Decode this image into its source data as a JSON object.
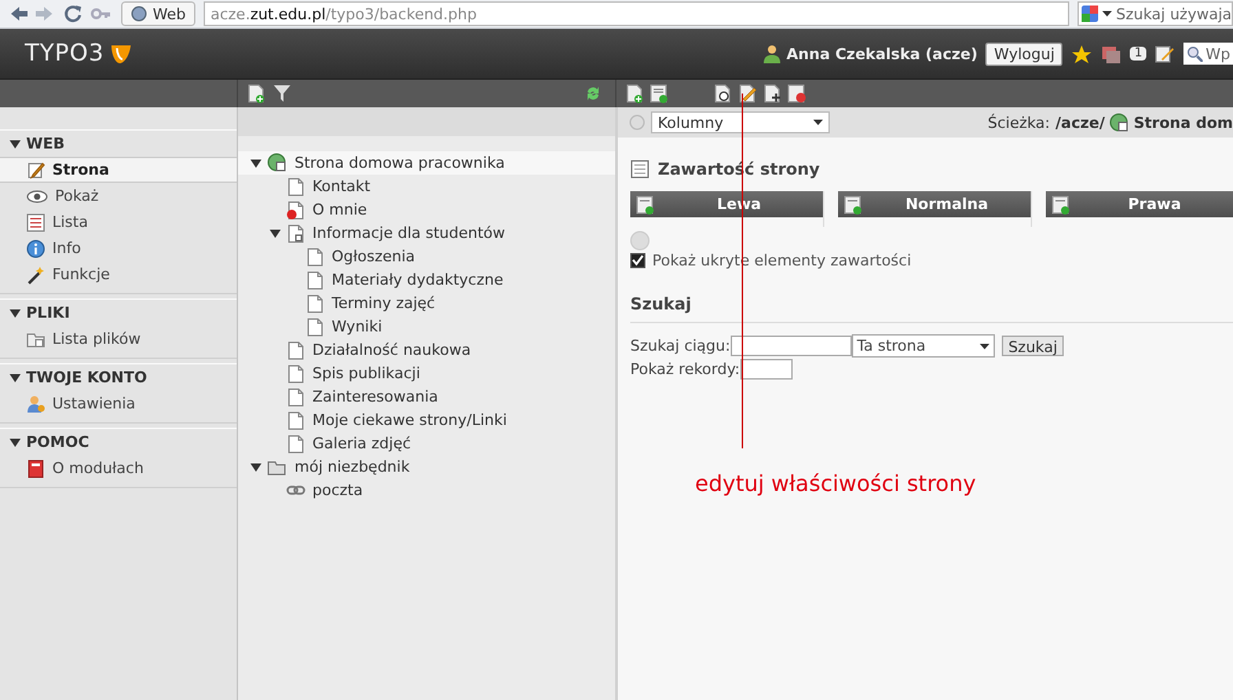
{
  "browser": {
    "web_label": "Web",
    "url": "acze.**zut.edu.pl**/typo3/backend.php",
    "search_placeholder": "Szukaj używaja"
  },
  "header": {
    "logo": "TYPO3",
    "user": "Anna Czekalska (acze)",
    "logout": "Wyloguj",
    "badge": "1",
    "search_placeholder": "Wp"
  },
  "modules": [
    {
      "title": "WEB",
      "expanded": true,
      "items": [
        {
          "label": "Strona",
          "kind": "page",
          "selected": true
        },
        {
          "label": "Pokaż",
          "kind": "view",
          "selected": false
        },
        {
          "label": "Lista",
          "kind": "list",
          "selected": false
        },
        {
          "label": "Info",
          "kind": "info",
          "selected": false
        },
        {
          "label": "Funkcje",
          "kind": "wand",
          "selected": false
        }
      ]
    },
    {
      "title": "PLIKI",
      "expanded": true,
      "items": [
        {
          "label": "Lista plików",
          "kind": "files",
          "selected": false
        }
      ]
    },
    {
      "title": "TWOJE KONTO",
      "expanded": true,
      "items": [
        {
          "label": "Ustawienia",
          "kind": "user",
          "selected": false
        }
      ]
    },
    {
      "title": "POMOC",
      "expanded": true,
      "items": [
        {
          "label": "O modułach",
          "kind": "book",
          "selected": false
        }
      ]
    }
  ],
  "tree": [
    {
      "label": "Strona domowa pracownika",
      "kind": "root",
      "expanded": true,
      "selected": true,
      "children": [
        {
          "label": "Kontakt",
          "kind": "page",
          "selected": false
        },
        {
          "label": "O mnie",
          "kind": "restricted",
          "selected": false
        },
        {
          "label": "Informacje dla studentów",
          "kind": "shortcut",
          "expanded": true,
          "selected": false,
          "children": [
            {
              "label": "Ogłoszenia",
              "kind": "page",
              "selected": false
            },
            {
              "label": "Materiały dydaktyczne",
              "kind": "page",
              "selected": false
            },
            {
              "label": "Terminy zajęć",
              "kind": "page",
              "selected": false
            },
            {
              "label": "Wyniki",
              "kind": "page",
              "selected": false
            }
          ]
        },
        {
          "label": "Działalność naukowa",
          "kind": "page",
          "selected": false
        },
        {
          "label": "Spis publikacji",
          "kind": "page",
          "selected": false
        },
        {
          "label": "Zainteresowania",
          "kind": "page",
          "selected": false
        },
        {
          "label": "Moje ciekawe strony/Linki",
          "kind": "page",
          "selected": false
        },
        {
          "label": "Galeria zdjęć",
          "kind": "page",
          "selected": false
        }
      ]
    },
    {
      "label": "mój niezbędnik",
      "kind": "folder",
      "expanded": true,
      "selected": false,
      "children": [
        {
          "label": "poczta",
          "kind": "link",
          "selected": false
        }
      ]
    }
  ],
  "content": {
    "view": "Kolumny",
    "path_label": "Ścieżka:",
    "path": "/acze/",
    "path_page": "Strona dom",
    "section_title": "Zawartość strony",
    "columns": [
      "Lewa",
      "Normalna",
      "Prawa"
    ],
    "show_hidden": {
      "label": "Pokaż ukryte elementy zawartości",
      "checked": true
    },
    "search": {
      "title": "Szukaj",
      "query_label": "Szukaj ciągu:",
      "scope": "Ta strona",
      "button": "Szukaj",
      "records_label": "Pokaż rekordy:"
    }
  },
  "annotation": {
    "text": "edytuj właściwości strony"
  }
}
